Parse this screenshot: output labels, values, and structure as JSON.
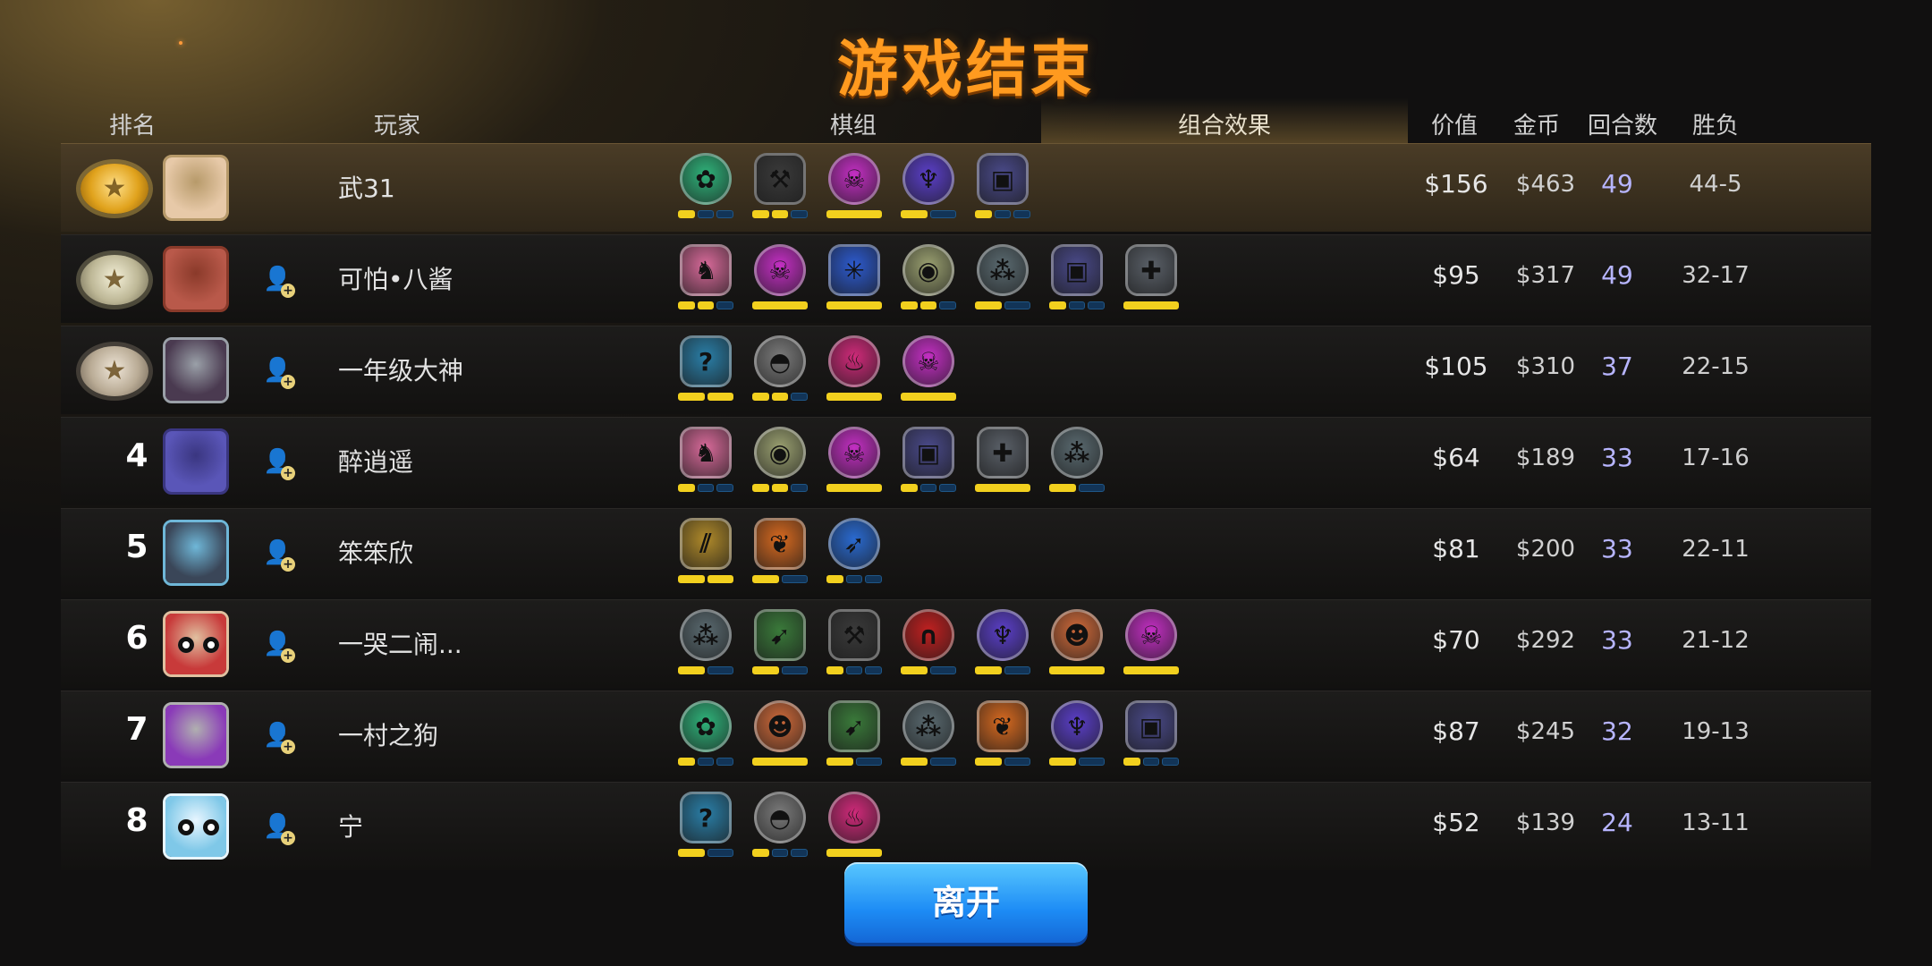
{
  "title": "游戏结束",
  "header": {
    "rank": "排名",
    "player": "玩家",
    "board": "棋组",
    "combo_tab": "组合效果",
    "value": "价值",
    "gold": "金币",
    "rounds": "回合数",
    "win_loss": "胜负"
  },
  "colors": {
    "title": "#ff9a1f",
    "row_highlight": "#4a3c26",
    "bar_active": "#f2d01e",
    "bar_inactive": "#123457",
    "rounds_text": "#b7b5ff",
    "button": "#1d8cf5"
  },
  "rows": [
    {
      "rank": "1",
      "medal": "gold",
      "avatar": "pig-avatar",
      "show_add": false,
      "name": "武31",
      "value": "$156",
      "gold": "$463",
      "rounds": "49",
      "wl": "44-5",
      "traits": [
        {
          "icon": "paw-icon",
          "color": "#2fb37a",
          "hex": false,
          "bars": 3,
          "active": 1
        },
        {
          "icon": "axe-icon",
          "color": "#3a3a3a",
          "hex": true,
          "bars": 3,
          "active": 2
        },
        {
          "icon": "demon-icon",
          "color": "#c42fc4",
          "hex": false,
          "bars": 1,
          "active": 1
        },
        {
          "icon": "fishbone-icon",
          "color": "#5b3fc9",
          "hex": false,
          "bars": 2,
          "active": 1
        },
        {
          "icon": "spellbook-icon",
          "color": "#4a4a8a",
          "hex": true,
          "bars": 3,
          "active": 1
        }
      ]
    },
    {
      "rank": "2",
      "medal": "silver",
      "avatar": "warrior-avatar",
      "show_add": true,
      "name": "可怕•八酱",
      "value": "$95",
      "gold": "$317",
      "rounds": "49",
      "wl": "32-17",
      "traits": [
        {
          "icon": "knight-icon",
          "color": "#d86a9a",
          "hex": true,
          "bars": 3,
          "active": 2
        },
        {
          "icon": "demon-icon",
          "color": "#c42fc4",
          "hex": false,
          "bars": 1,
          "active": 1
        },
        {
          "icon": "ice-icon",
          "color": "#2d5bd0",
          "hex": true,
          "bars": 1,
          "active": 1
        },
        {
          "icon": "beast-icon",
          "color": "#9aa070",
          "hex": false,
          "bars": 3,
          "active": 2
        },
        {
          "icon": "footprint-icon",
          "color": "#5a6a70",
          "hex": false,
          "bars": 2,
          "active": 1
        },
        {
          "icon": "spellbook-icon",
          "color": "#4a4a8a",
          "hex": true,
          "bars": 3,
          "active": 1
        },
        {
          "icon": "cross-icon",
          "color": "#5a6068",
          "hex": true,
          "bars": 1,
          "active": 1
        }
      ]
    },
    {
      "rank": "3",
      "medal": "bronze",
      "avatar": "dark-wizard-avatar",
      "show_add": true,
      "name": "一年级大神",
      "value": "$105",
      "gold": "$310",
      "rounds": "37",
      "wl": "22-15",
      "traits": [
        {
          "icon": "question-icon",
          "color": "#2a7fa8",
          "hex": true,
          "bars": 2,
          "active": 2
        },
        {
          "icon": "goblin-icon",
          "color": "#7a7a7a",
          "hex": false,
          "bars": 3,
          "active": 2
        },
        {
          "icon": "dragon-icon",
          "color": "#d02a7a",
          "hex": false,
          "bars": 1,
          "active": 1
        },
        {
          "icon": "demon-icon",
          "color": "#c42fc4",
          "hex": false,
          "bars": 1,
          "active": 1
        }
      ]
    },
    {
      "rank": "4",
      "medal": "",
      "avatar": "hooded-avatar",
      "show_add": true,
      "name": "醉逍遥",
      "value": "$64",
      "gold": "$189",
      "rounds": "33",
      "wl": "17-16",
      "traits": [
        {
          "icon": "knight-icon",
          "color": "#d86a9a",
          "hex": true,
          "bars": 3,
          "active": 1
        },
        {
          "icon": "beast-icon",
          "color": "#9aa070",
          "hex": false,
          "bars": 3,
          "active": 2
        },
        {
          "icon": "demon-icon",
          "color": "#c42fc4",
          "hex": false,
          "bars": 1,
          "active": 1
        },
        {
          "icon": "spellbook-icon",
          "color": "#4a4a8a",
          "hex": true,
          "bars": 3,
          "active": 1
        },
        {
          "icon": "cross-icon",
          "color": "#5a6068",
          "hex": true,
          "bars": 1,
          "active": 1
        },
        {
          "icon": "footprint-icon",
          "color": "#5a6a70",
          "hex": false,
          "bars": 2,
          "active": 1
        }
      ]
    },
    {
      "rank": "5",
      "medal": "",
      "avatar": "frost-wizard-avatar",
      "show_add": true,
      "name": "笨笨欣",
      "value": "$81",
      "gold": "$200",
      "rounds": "33",
      "wl": "22-11",
      "traits": [
        {
          "icon": "claw-icon",
          "color": "#b08a2a",
          "hex": true,
          "bars": 2,
          "active": 2
        },
        {
          "icon": "feather-icon",
          "color": "#d86a20",
          "hex": true,
          "bars": 2,
          "active": 1
        },
        {
          "icon": "blue-feather-icon",
          "color": "#2a6ad0",
          "hex": false,
          "bars": 3,
          "active": 1
        }
      ]
    },
    {
      "rank": "6",
      "medal": "",
      "avatar": "robot-avatar",
      "show_add": true,
      "name": "一哭二闹...",
      "value": "$70",
      "gold": "$292",
      "rounds": "33",
      "wl": "21-12",
      "traits": [
        {
          "icon": "footprint-icon",
          "color": "#5a6a70",
          "hex": false,
          "bars": 2,
          "active": 1
        },
        {
          "icon": "bow-icon",
          "color": "#3a7a3a",
          "hex": true,
          "bars": 2,
          "active": 1
        },
        {
          "icon": "axe-icon",
          "color": "#3a3a3a",
          "hex": true,
          "bars": 3,
          "active": 1
        },
        {
          "icon": "arch-icon",
          "color": "#c02020",
          "hex": false,
          "bars": 2,
          "active": 1
        },
        {
          "icon": "fishbone-icon",
          "color": "#5b3fc9",
          "hex": false,
          "bars": 2,
          "active": 1
        },
        {
          "icon": "orc-icon",
          "color": "#d06a3a",
          "hex": false,
          "bars": 1,
          "active": 1
        },
        {
          "icon": "demon-icon",
          "color": "#c42fc4",
          "hex": false,
          "bars": 1,
          "active": 1
        }
      ]
    },
    {
      "rank": "7",
      "medal": "",
      "avatar": "purple-wizard-avatar",
      "show_add": true,
      "name": "一村之狗",
      "value": "$87",
      "gold": "$245",
      "rounds": "32",
      "wl": "19-13",
      "traits": [
        {
          "icon": "paw-icon",
          "color": "#2fb37a",
          "hex": false,
          "bars": 3,
          "active": 1
        },
        {
          "icon": "orc-icon",
          "color": "#d06a3a",
          "hex": false,
          "bars": 1,
          "active": 1
        },
        {
          "icon": "bow-icon",
          "color": "#3a7a3a",
          "hex": true,
          "bars": 2,
          "active": 1
        },
        {
          "icon": "footprint-icon",
          "color": "#5a6a70",
          "hex": false,
          "bars": 2,
          "active": 1
        },
        {
          "icon": "feather-icon",
          "color": "#d86a20",
          "hex": true,
          "bars": 2,
          "active": 1
        },
        {
          "icon": "fishbone-icon",
          "color": "#5b3fc9",
          "hex": false,
          "bars": 2,
          "active": 1
        },
        {
          "icon": "spellbook-icon",
          "color": "#4a4a8a",
          "hex": true,
          "bars": 3,
          "active": 1
        }
      ]
    },
    {
      "rank": "8",
      "medal": "",
      "avatar": "dice-avatar",
      "show_add": true,
      "name": "宁",
      "value": "$52",
      "gold": "$139",
      "rounds": "24",
      "wl": "13-11",
      "traits": [
        {
          "icon": "question-icon",
          "color": "#2a7fa8",
          "hex": true,
          "bars": 2,
          "active": 1
        },
        {
          "icon": "goblin-icon",
          "color": "#7a7a7a",
          "hex": false,
          "bars": 3,
          "active": 1
        },
        {
          "icon": "dragon-icon",
          "color": "#d02a7a",
          "hex": false,
          "bars": 1,
          "active": 1
        }
      ]
    }
  ],
  "leave_button": "离开"
}
